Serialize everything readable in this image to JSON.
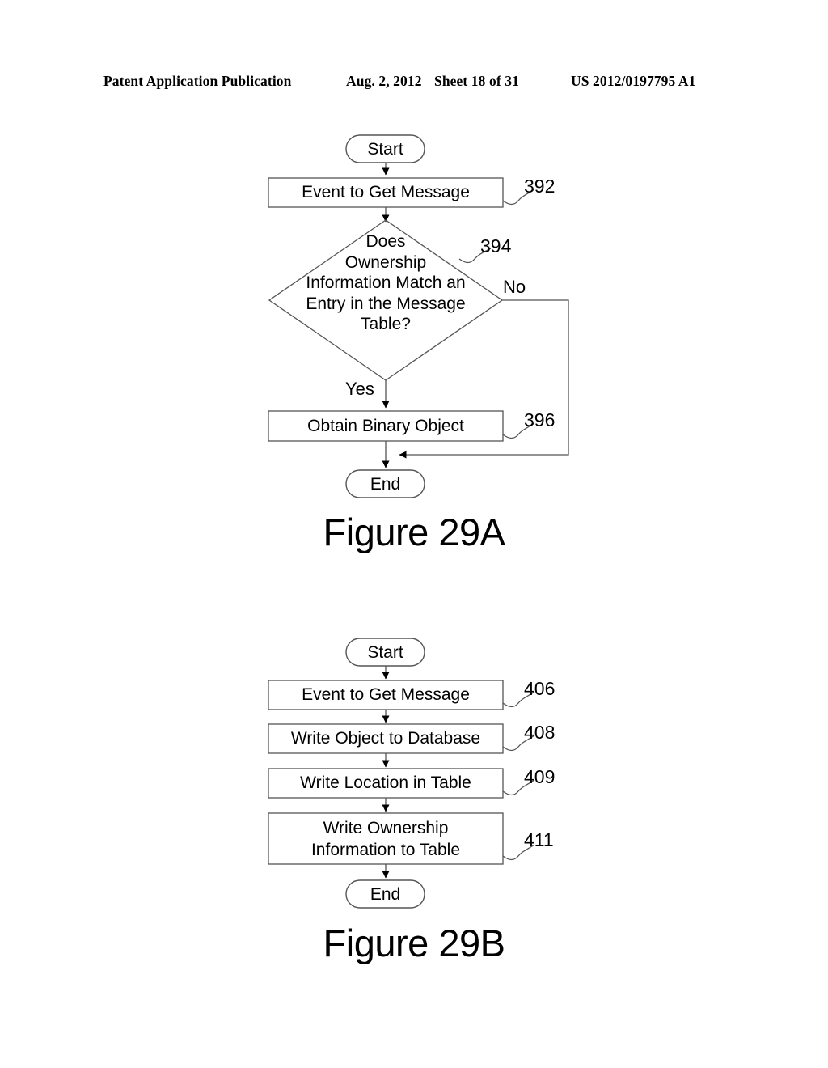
{
  "header": {
    "publication": "Patent Application Publication",
    "date": "Aug. 2, 2012",
    "sheet": "Sheet 18 of 31",
    "patent_number": "US 2012/0197795 A1"
  },
  "figures": [
    {
      "caption": "Figure 29A",
      "start_label": "Start",
      "end_label": "End",
      "nodes": [
        {
          "text": "Event to Get Message",
          "ref": "392",
          "shape": "process"
        },
        {
          "text": "Does\nOwnership\nInformation Match an\nEntry in the Message\nTable?",
          "ref": "394",
          "shape": "decision"
        },
        {
          "text": "Obtain Binary Object",
          "ref": "396",
          "shape": "process"
        }
      ],
      "branches": {
        "yes": "Yes",
        "no": "No"
      }
    },
    {
      "caption": "Figure 29B",
      "start_label": "Start",
      "end_label": "End",
      "nodes": [
        {
          "text": "Event to Get Message",
          "ref": "406",
          "shape": "process"
        },
        {
          "text": "Write Object to Database",
          "ref": "408",
          "shape": "process"
        },
        {
          "text": "Write Location in Table",
          "ref": "409",
          "shape": "process"
        },
        {
          "text": "Write Ownership\nInformation to Table",
          "ref": "411",
          "shape": "process"
        }
      ]
    }
  ],
  "colors": {
    "stroke": "#000000",
    "background": "#ffffff",
    "text": "#000000"
  }
}
